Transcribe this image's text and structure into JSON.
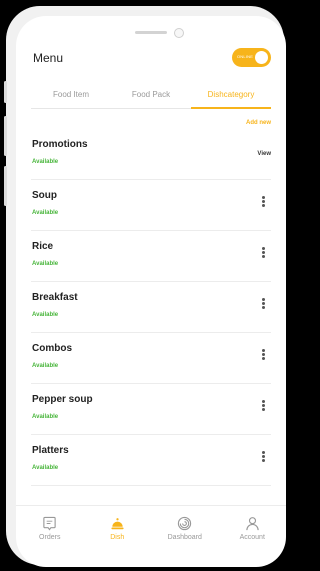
{
  "header": {
    "title": "Menu",
    "toggle_label": "ONLINE",
    "toggle_on": true
  },
  "tabs": [
    {
      "label": "Food Item",
      "active": false
    },
    {
      "label": "Food Pack",
      "active": false
    },
    {
      "label": "Dishcategory",
      "active": true
    }
  ],
  "add_new_label": "Add new",
  "categories": [
    {
      "title": "Promotions",
      "status": "Available",
      "action": "View"
    },
    {
      "title": "Soup",
      "status": "Available"
    },
    {
      "title": "Rice",
      "status": "Available"
    },
    {
      "title": "Breakfast",
      "status": "Available"
    },
    {
      "title": "Combos",
      "status": "Available"
    },
    {
      "title": "Pepper soup",
      "status": "Available"
    },
    {
      "title": "Platters",
      "status": "Available"
    }
  ],
  "bottom_nav": [
    {
      "label": "Orders",
      "icon": "orders-icon",
      "active": false
    },
    {
      "label": "Dish",
      "icon": "dish-icon",
      "active": true
    },
    {
      "label": "Dashboard",
      "icon": "dashboard-icon",
      "active": false
    },
    {
      "label": "Account",
      "icon": "account-icon",
      "active": false
    }
  ],
  "colors": {
    "accent": "#f7b41b",
    "available": "#47b53a"
  }
}
